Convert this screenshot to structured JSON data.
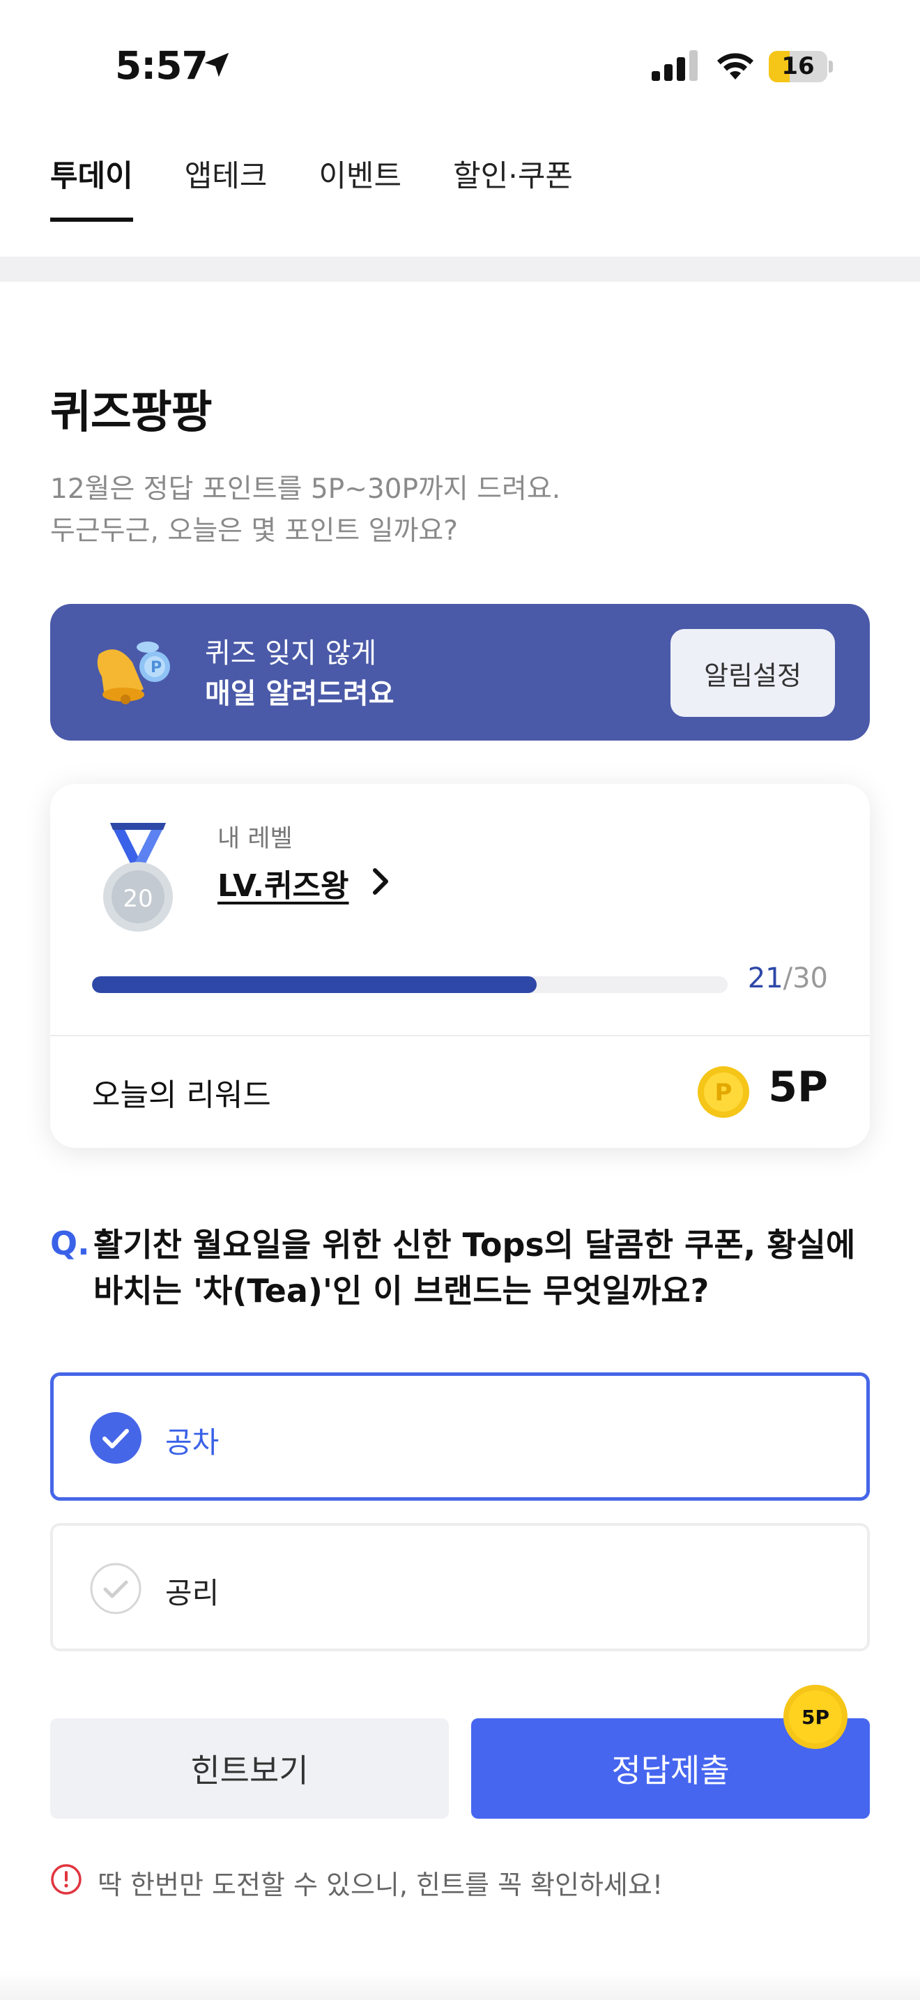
{
  "status_bar": {
    "time": "5:57",
    "battery": "16",
    "battery_level": 0.16
  },
  "tabs": [
    {
      "label": "투데이",
      "active": true
    },
    {
      "label": "앱테크",
      "active": false
    },
    {
      "label": "이벤트",
      "active": false
    },
    {
      "label": "할인·쿠폰",
      "active": false
    }
  ],
  "quiz": {
    "title": "퀴즈팡팡",
    "subtitle": "12월은 정답 포인트를 5P~30P까지 드려요.\n두근두근, 오늘은 몇 포인트 일까요?"
  },
  "banner": {
    "line1": "퀴즈 잊지 않게",
    "line2": "매일 알려드려요",
    "button": "알림설정"
  },
  "level": {
    "caption": "내 레벨",
    "name": "LV.퀴즈왕",
    "medal_number": "20",
    "progress_current": "21",
    "progress_total": "/30",
    "progress_fraction": 0.7,
    "reward_label": "오늘의 리워드",
    "reward_value": "5P"
  },
  "question": {
    "prefix": "Q.",
    "text": "활기찬 월요일을 위한 신한 Tops의 달콤한 쿠폰, 황실에 바치는 '차(Tea)'인 이 브랜드는 무엇일까요?"
  },
  "options": [
    {
      "label": "공차",
      "selected": true
    },
    {
      "label": "공리",
      "selected": false
    }
  ],
  "actions": {
    "hint": "힌트보기",
    "submit": "정답제출",
    "badge": "5P"
  },
  "notice": "딱 한번만 도전할 수 있으니, 힌트를 꼭 확인하세요!",
  "colors": {
    "accent": "#4666f0",
    "banner": "#4a5aa8",
    "progress": "#2e48a8",
    "badge": "#f5c518"
  }
}
